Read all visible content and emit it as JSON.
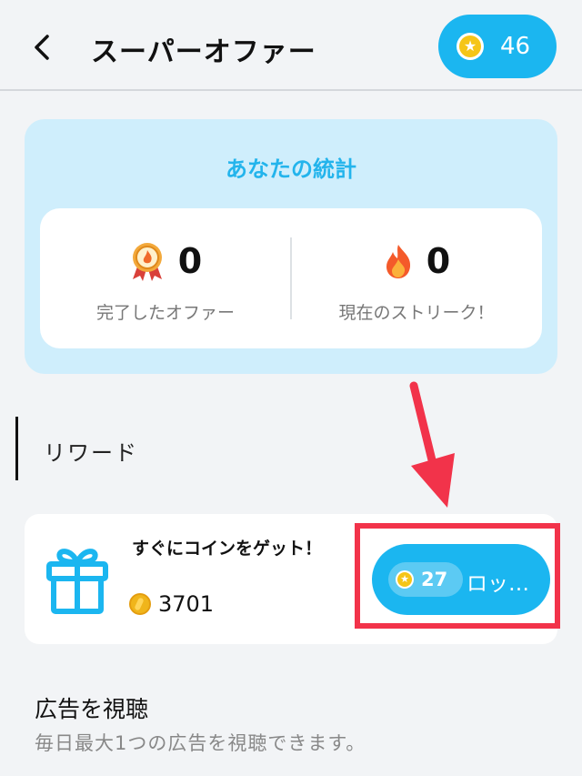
{
  "header": {
    "title": "スーパーオファー",
    "coin_balance": "46"
  },
  "stats": {
    "title": "あなたの統計",
    "completed": {
      "value": "0",
      "label": "完了したオファー"
    },
    "streak": {
      "value": "0",
      "label": "現在のストリーク！"
    }
  },
  "rewards": {
    "section_title": "リワード",
    "offer": {
      "title": "すぐにコインをゲット！",
      "coins": "3701",
      "button_cost": "27",
      "button_label": "ロッ…"
    }
  },
  "ads": {
    "title": "広告を視聴",
    "subtitle": "毎日最大1つの広告を視聴できます。"
  },
  "colors": {
    "accent": "#1bb6f0",
    "stats_bg": "#cfeefc",
    "highlight": "#f2334a"
  }
}
